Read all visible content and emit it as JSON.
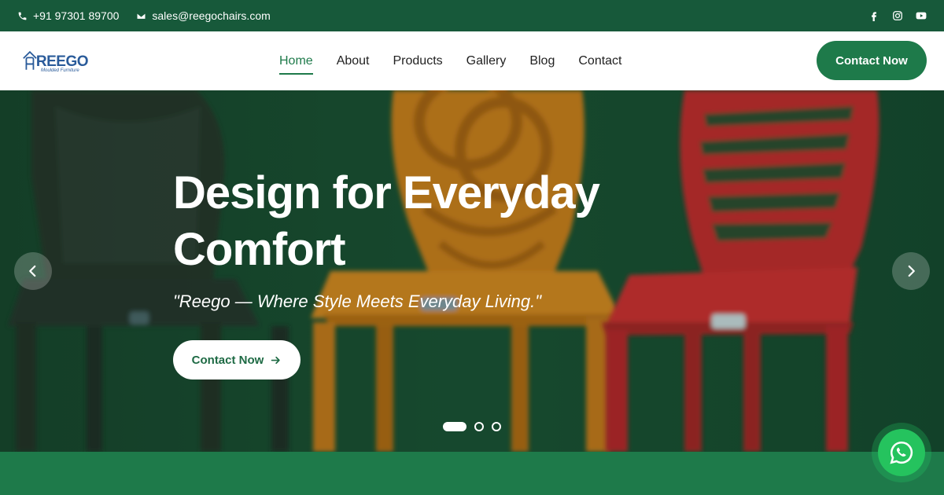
{
  "topbar": {
    "phone": "+91 97301 89700",
    "email": "sales@reegochairs.com",
    "socials": [
      "facebook-icon",
      "instagram-icon",
      "youtube-icon"
    ]
  },
  "header": {
    "logo_text": "REEGO",
    "logo_sub": "Moulded Furniture",
    "nav": [
      {
        "label": "Home",
        "active": true
      },
      {
        "label": "About",
        "active": false
      },
      {
        "label": "Products",
        "active": false
      },
      {
        "label": "Gallery",
        "active": false
      },
      {
        "label": "Blog",
        "active": false
      },
      {
        "label": "Contact",
        "active": false
      }
    ],
    "cta_label": "Contact Now"
  },
  "hero": {
    "title": "Design for Everyday Comfort",
    "tagline": "\"Reego — Where Style Meets Everyday Living.\"",
    "cta_label": "Contact Now",
    "slides_total": 3,
    "active_slide": 1
  },
  "colors": {
    "brand_green": "#1e7a4a",
    "topbar_green": "#17593a",
    "hero_bg": "#12492e",
    "chair_black": "#2a2a28",
    "chair_orange": "#e8871a",
    "chair_red": "#d5222a",
    "whatsapp": "#25c35e"
  }
}
